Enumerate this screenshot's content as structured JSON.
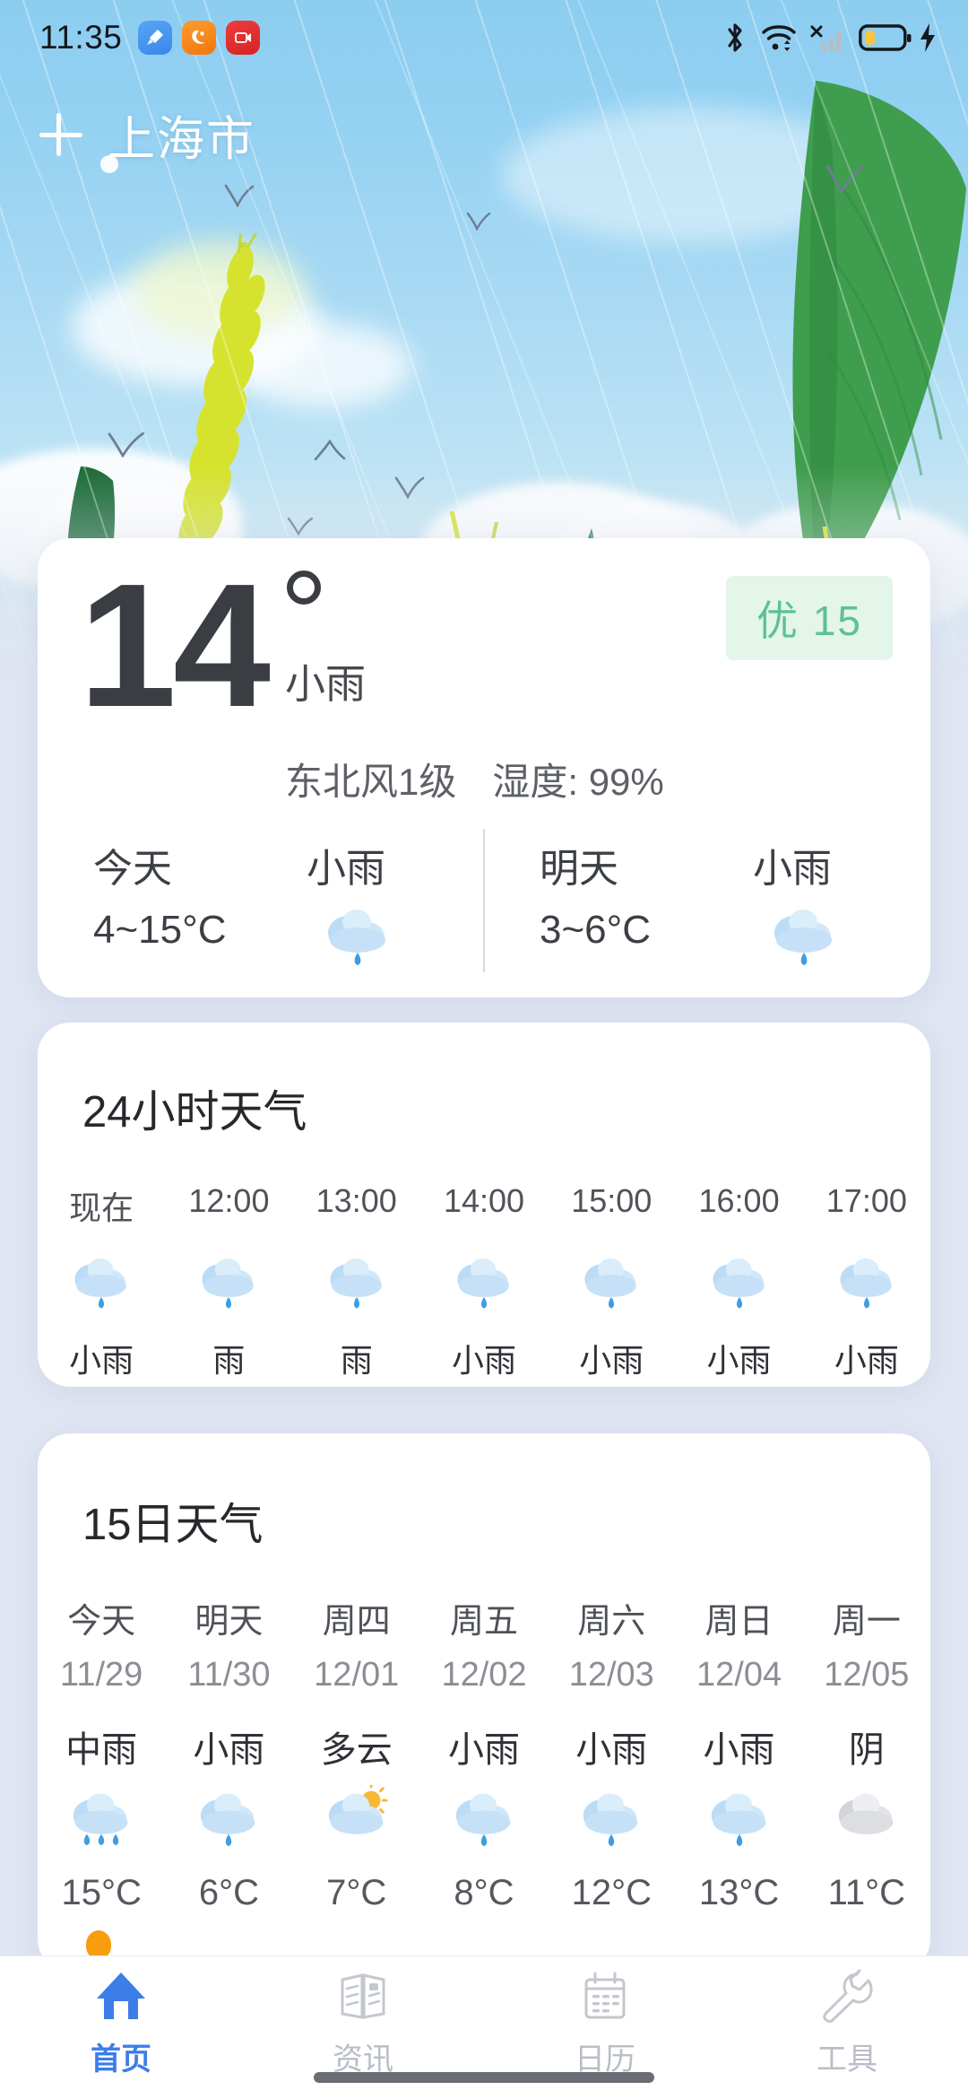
{
  "statusbar": {
    "time": "11:35",
    "app_icons": [
      {
        "name": "cleaner-app-icon"
      },
      {
        "name": "uc-browser-app-icon"
      },
      {
        "name": "screen-recorder-app-icon"
      }
    ],
    "system_icons": [
      {
        "name": "bluetooth-icon"
      },
      {
        "name": "wifi-icon"
      },
      {
        "name": "cellular-signal-off-icon"
      },
      {
        "name": "battery-charging-icon"
      }
    ]
  },
  "header": {
    "add_city_label": "+",
    "city": "上海市"
  },
  "current": {
    "temperature": "14",
    "degree_symbol": "°",
    "condition": "小雨",
    "wind": "东北风1级",
    "humidity": "湿度: 99%",
    "aqi_badge": "优 15",
    "aqi_color": "#5fc095",
    "aqi_bg": "#e4f5ea",
    "today": {
      "label": "今天",
      "range": "4~15°C",
      "condition": "小雨",
      "icon": "light-rain-icon"
    },
    "tomorrow": {
      "label": "明天",
      "range": "3~6°C",
      "condition": "小雨",
      "icon": "light-rain-icon"
    }
  },
  "hourly": {
    "title": "24小时天气",
    "items": [
      {
        "time": "现在",
        "condition": "小雨",
        "icon": "light-rain-icon"
      },
      {
        "time": "12:00",
        "condition": "雨",
        "icon": "rain-icon"
      },
      {
        "time": "13:00",
        "condition": "雨",
        "icon": "rain-icon"
      },
      {
        "time": "14:00",
        "condition": "小雨",
        "icon": "light-rain-icon"
      },
      {
        "time": "15:00",
        "condition": "小雨",
        "icon": "light-rain-icon"
      },
      {
        "time": "16:00",
        "condition": "小雨",
        "icon": "light-rain-icon"
      },
      {
        "time": "17:00",
        "condition": "小雨",
        "icon": "light-rain-icon"
      }
    ]
  },
  "daily": {
    "title": "15日天气",
    "items": [
      {
        "name": "今天",
        "date": "11/29",
        "condition": "中雨",
        "temp": "15°C",
        "icon": "moderate-rain-icon"
      },
      {
        "name": "明天",
        "date": "11/30",
        "condition": "小雨",
        "temp": "6°C",
        "icon": "light-rain-icon"
      },
      {
        "name": "周四",
        "date": "12/01",
        "condition": "多云",
        "temp": "7°C",
        "icon": "partly-cloudy-icon"
      },
      {
        "name": "周五",
        "date": "12/02",
        "condition": "小雨",
        "temp": "8°C",
        "icon": "light-rain-icon"
      },
      {
        "name": "周六",
        "date": "12/03",
        "condition": "小雨",
        "temp": "12°C",
        "icon": "light-rain-icon"
      },
      {
        "name": "周日",
        "date": "12/04",
        "condition": "小雨",
        "temp": "13°C",
        "icon": "light-rain-icon"
      },
      {
        "name": "周一",
        "date": "12/05",
        "condition": "阴",
        "temp": "11°C",
        "icon": "overcast-icon"
      }
    ]
  },
  "navbar": {
    "items": [
      {
        "label": "首页",
        "icon": "home-icon",
        "active": true
      },
      {
        "label": "资讯",
        "icon": "news-icon",
        "active": false
      },
      {
        "label": "日历",
        "icon": "calendar-icon",
        "active": false
      },
      {
        "label": "工具",
        "icon": "wrench-icon",
        "active": false
      }
    ],
    "active_color": "#3c7de8",
    "inactive_color": "#b9bdc6"
  }
}
